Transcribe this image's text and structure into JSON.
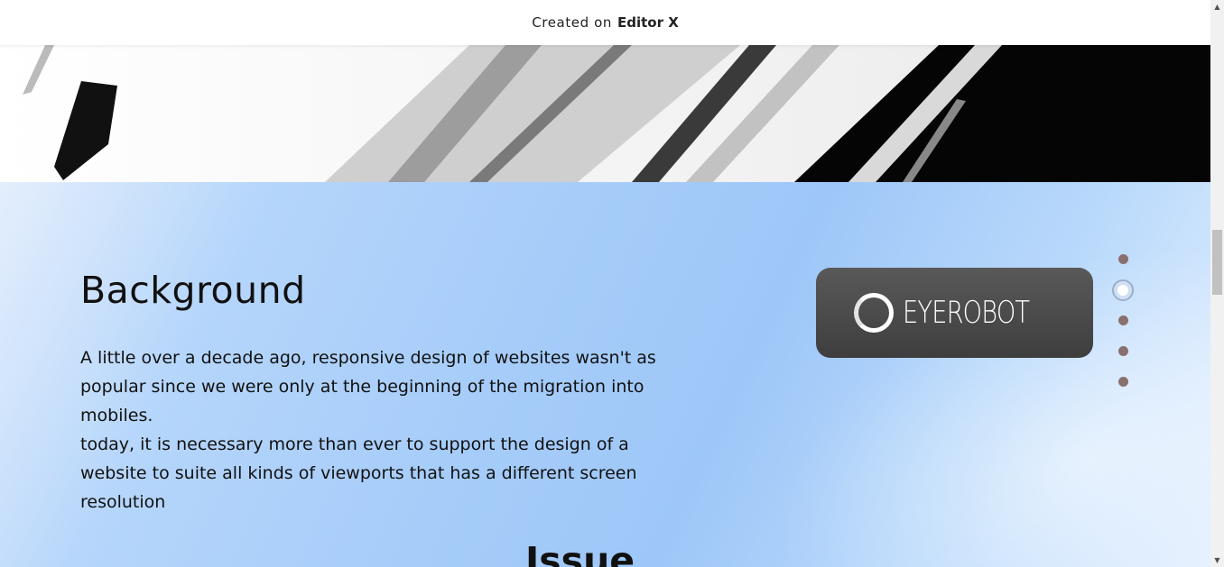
{
  "topbar": {
    "created_label": "Created on",
    "brand": "Editor X"
  },
  "hero": {
    "title": "Background",
    "paragraph_1": "A little over a decade ago, responsive design of websites wasn't as popular since we were only at the beginning of the migration into mobiles.",
    "paragraph_2": "today, it is necessary more than ever to support the design of a website to suite all kinds of viewports that has a different screen resolution",
    "logo_text": "EYEROBOT",
    "next_title": "Issue"
  },
  "nav_dots": {
    "count": 5,
    "active_index": 1,
    "color": "#8a6f6f"
  },
  "colors": {
    "hero_bg": "#a7cdf9",
    "logo_card": "#474747",
    "text": "#111111"
  },
  "scrollbar": {
    "up_icon": "▲",
    "down_icon": "▼"
  }
}
